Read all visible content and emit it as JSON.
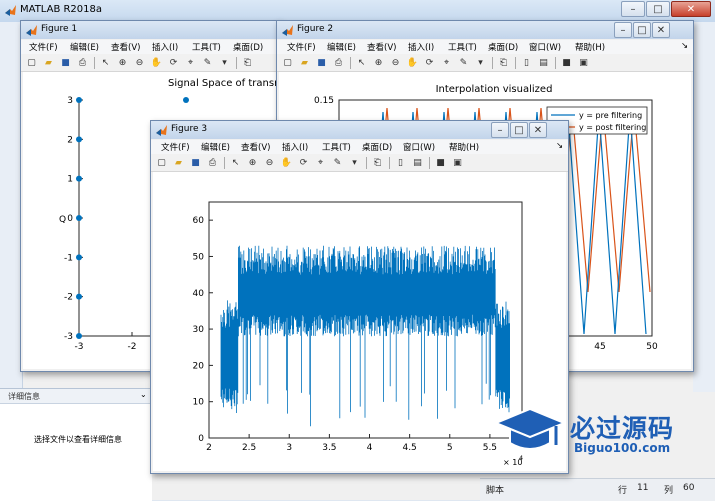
{
  "app": {
    "title": "MATLAB R2018a",
    "minimize_glyph": "–",
    "maximize_glyph": "□",
    "close_glyph": "✕"
  },
  "detail_panel": {
    "title": "详细信息",
    "message": "选择文件以查看详细信息"
  },
  "status_bar": {
    "script_label": "脚本",
    "row_label": "行",
    "row_value": "11",
    "col_label": "列",
    "col_value": "60"
  },
  "menus": [
    "文件(F)",
    "编辑(E)",
    "查看(V)",
    "插入(I)",
    "工具(T)",
    "桌面(D)",
    "窗口(W)",
    "帮助(H)"
  ],
  "figure1": {
    "title": "Figure 1",
    "plot_title": "Signal Space of transmi",
    "ylabel": "Q",
    "yticks": [
      "3",
      "2",
      "1",
      "0",
      "-1",
      "-2",
      "-3"
    ],
    "xticks": [
      "-3",
      "-2"
    ]
  },
  "figure2": {
    "title": "Figure 2",
    "plot_title": "Interpolation visualized",
    "ytick_top": "0.15",
    "xticks": [
      "45",
      "50"
    ],
    "legend": [
      "y = pre filtering",
      "y = post filtering"
    ]
  },
  "figure3": {
    "title": "Figure 3",
    "yticks": [
      "60",
      "50",
      "40",
      "30",
      "20",
      "10",
      "0"
    ],
    "xticks": [
      "2",
      "2.5",
      "3",
      "3.5",
      "4",
      "4.5",
      "5",
      "5.5"
    ],
    "x_exponent_base": "× 10",
    "x_exponent_power": "4"
  },
  "watermark": {
    "text": "必过源码",
    "url": "Biguo100.com"
  },
  "colors": {
    "series_blue": "#0072bd",
    "series_orange": "#d95319",
    "titlebar": "#c8d9ef"
  }
}
